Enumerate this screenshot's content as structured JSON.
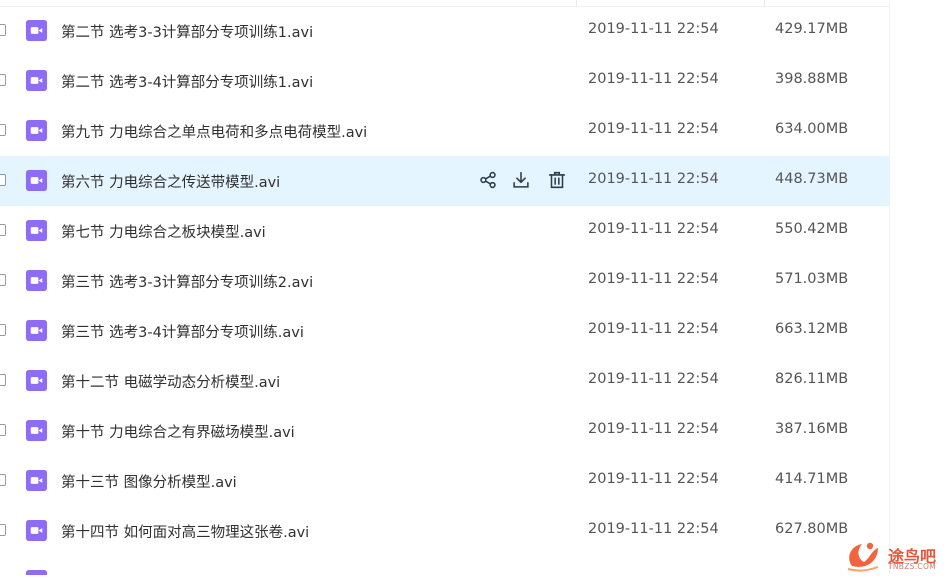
{
  "colors": {
    "file_icon": "#8e6cf7",
    "hover_row": "#e5f5ff",
    "action_icon": "#2f3a4a",
    "watermark": "#e2583e"
  },
  "icons": {
    "file": "video-file-icon",
    "share": "share-icon",
    "download": "download-icon",
    "delete": "trash-icon"
  },
  "files": [
    {
      "name": "第二节 选考3-3计算部分专项训练1.avi",
      "date": "2019-11-11 22:54",
      "size": "429.17MB"
    },
    {
      "name": "第二节 选考3-4计算部分专项训练1.avi",
      "date": "2019-11-11 22:54",
      "size": "398.88MB"
    },
    {
      "name": "第九节 力电综合之单点电荷和多点电荷模型.avi",
      "date": "2019-11-11 22:54",
      "size": "634.00MB"
    },
    {
      "name": "第六节 力电综合之传送带模型.avi",
      "date": "2019-11-11 22:54",
      "size": "448.73MB",
      "hovered": true
    },
    {
      "name": "第七节 力电综合之板块模型.avi",
      "date": "2019-11-11 22:54",
      "size": "550.42MB"
    },
    {
      "name": "第三节 选考3-3计算部分专项训练2.avi",
      "date": "2019-11-11 22:54",
      "size": "571.03MB"
    },
    {
      "name": "第三节 选考3-4计算部分专项训练.avi",
      "date": "2019-11-11 22:54",
      "size": "663.12MB"
    },
    {
      "name": "第十二节 电磁学动态分析模型.avi",
      "date": "2019-11-11 22:54",
      "size": "826.11MB"
    },
    {
      "name": "第十节 力电综合之有界磁场模型.avi",
      "date": "2019-11-11 22:54",
      "size": "387.16MB"
    },
    {
      "name": "第十三节 图像分析模型.avi",
      "date": "2019-11-11 22:54",
      "size": "414.71MB"
    },
    {
      "name": "第十四节 如何面对高三物理这张卷.avi",
      "date": "2019-11-11 22:54",
      "size": "627.80MB"
    }
  ],
  "watermark": {
    "name": "途鸟吧",
    "url": "TNBZS.COM"
  }
}
